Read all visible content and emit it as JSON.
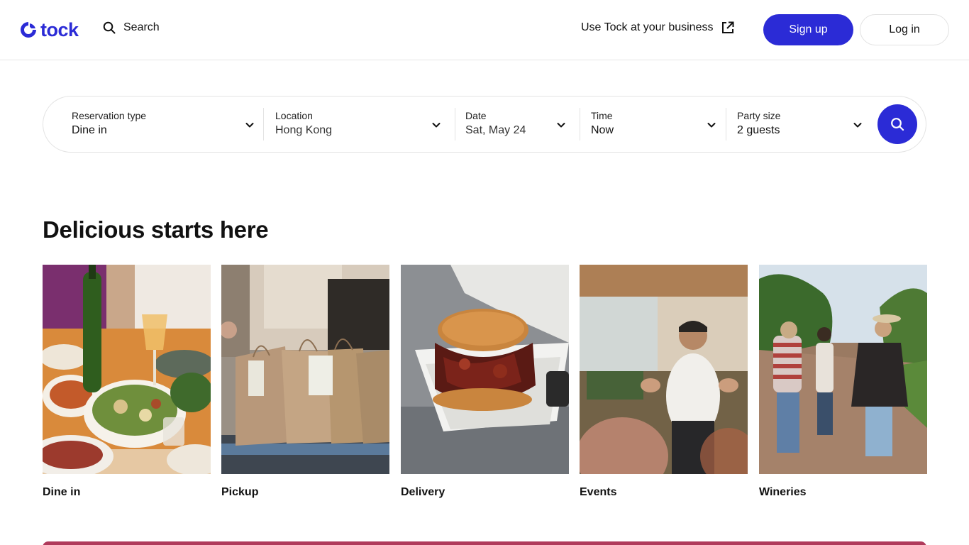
{
  "header": {
    "logo_text": "tock",
    "search_label": "Search",
    "business_link": "Use Tock at your business",
    "signup_label": "Sign up",
    "login_label": "Log in"
  },
  "search_bar": {
    "fields": [
      {
        "label": "Reservation type",
        "value": "Dine in"
      },
      {
        "label": "Location",
        "value": "Hong Kong"
      },
      {
        "label": "Date",
        "value": "Sat, May 24"
      },
      {
        "label": "Time",
        "value": "Now"
      },
      {
        "label": "Party size",
        "value": "2 guests"
      }
    ]
  },
  "section": {
    "title": "Delicious starts here",
    "cards": [
      {
        "title": "Dine in"
      },
      {
        "title": "Pickup"
      },
      {
        "title": "Delivery"
      },
      {
        "title": "Events"
      },
      {
        "title": "Wineries"
      }
    ]
  },
  "colors": {
    "brand": "#2b2bd6",
    "promo_banner": "#b03a5b"
  },
  "icons": {
    "search": "search-icon",
    "external": "external-link-icon",
    "chevron": "chevron-down-icon"
  }
}
